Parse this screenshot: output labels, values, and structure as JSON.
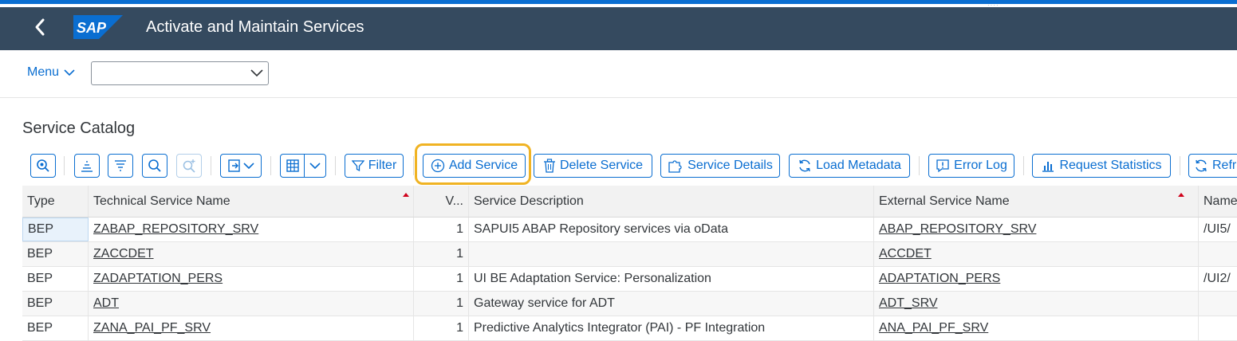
{
  "shell": {
    "title": "Activate and Maintain Services",
    "logo_text": "SAP",
    "brand_color": "#0a6ed1",
    "shell_color": "#354a5f"
  },
  "menubar": {
    "menu_label": "Menu",
    "command_field_value": ""
  },
  "section": {
    "title": "Service Catalog"
  },
  "toolbar": {
    "filter_label": "Filter",
    "add_service_label": "Add Service",
    "delete_service_label": "Delete Service",
    "service_details_label": "Service Details",
    "load_metadata_label": "Load Metadata",
    "error_log_label": "Error Log",
    "request_statistics_label": "Request Statistics",
    "refresh_label": "Refr",
    "highlight_color": "#f0b323"
  },
  "table": {
    "columns": {
      "type": "Type",
      "technical_name": "Technical Service Name",
      "version": "V...",
      "description": "Service Description",
      "external_name": "External Service Name",
      "namespace": "Name"
    },
    "rows": [
      {
        "type": "BEP",
        "technical_name": "ZABAP_REPOSITORY_SRV",
        "version": "1",
        "description": "SAPUI5 ABAP Repository services via oData",
        "external_name": "ABAP_REPOSITORY_SRV",
        "namespace": "/UI5/"
      },
      {
        "type": "BEP",
        "technical_name": "ZACCDET",
        "version": "1",
        "description": "",
        "external_name": "ACCDET",
        "namespace": ""
      },
      {
        "type": "BEP",
        "technical_name": "ZADAPTATION_PERS",
        "version": "1",
        "description": "UI BE Adaptation Service: Personalization",
        "external_name": "ADAPTATION_PERS",
        "namespace": "/UI2/"
      },
      {
        "type": "BEP",
        "technical_name": "ADT",
        "version": "1",
        "description": "Gateway service for ADT",
        "external_name": "ADT_SRV",
        "namespace": ""
      },
      {
        "type": "BEP",
        "technical_name": "ZANA_PAI_PF_SRV",
        "version": "1",
        "description": "Predictive Analytics Integrator (PAI) - PF Integration",
        "external_name": "ANA_PAI_PF_SRV",
        "namespace": ""
      }
    ]
  },
  "icons": {
    "back": "chevron-left-icon",
    "menu_dropdown": "chevron-down-icon",
    "zoom": "zoom-icon",
    "align": "align-icon",
    "list": "list-icon",
    "search": "search-icon",
    "search_add": "search-add-icon",
    "export": "export-icon",
    "layout": "table-grid-icon",
    "filter": "filter-icon",
    "add": "add-circle-icon",
    "delete": "trash-icon",
    "details": "puzzle-icon",
    "reload": "refresh-icon",
    "log": "alert-log-icon",
    "stats": "bar-chart-icon"
  }
}
